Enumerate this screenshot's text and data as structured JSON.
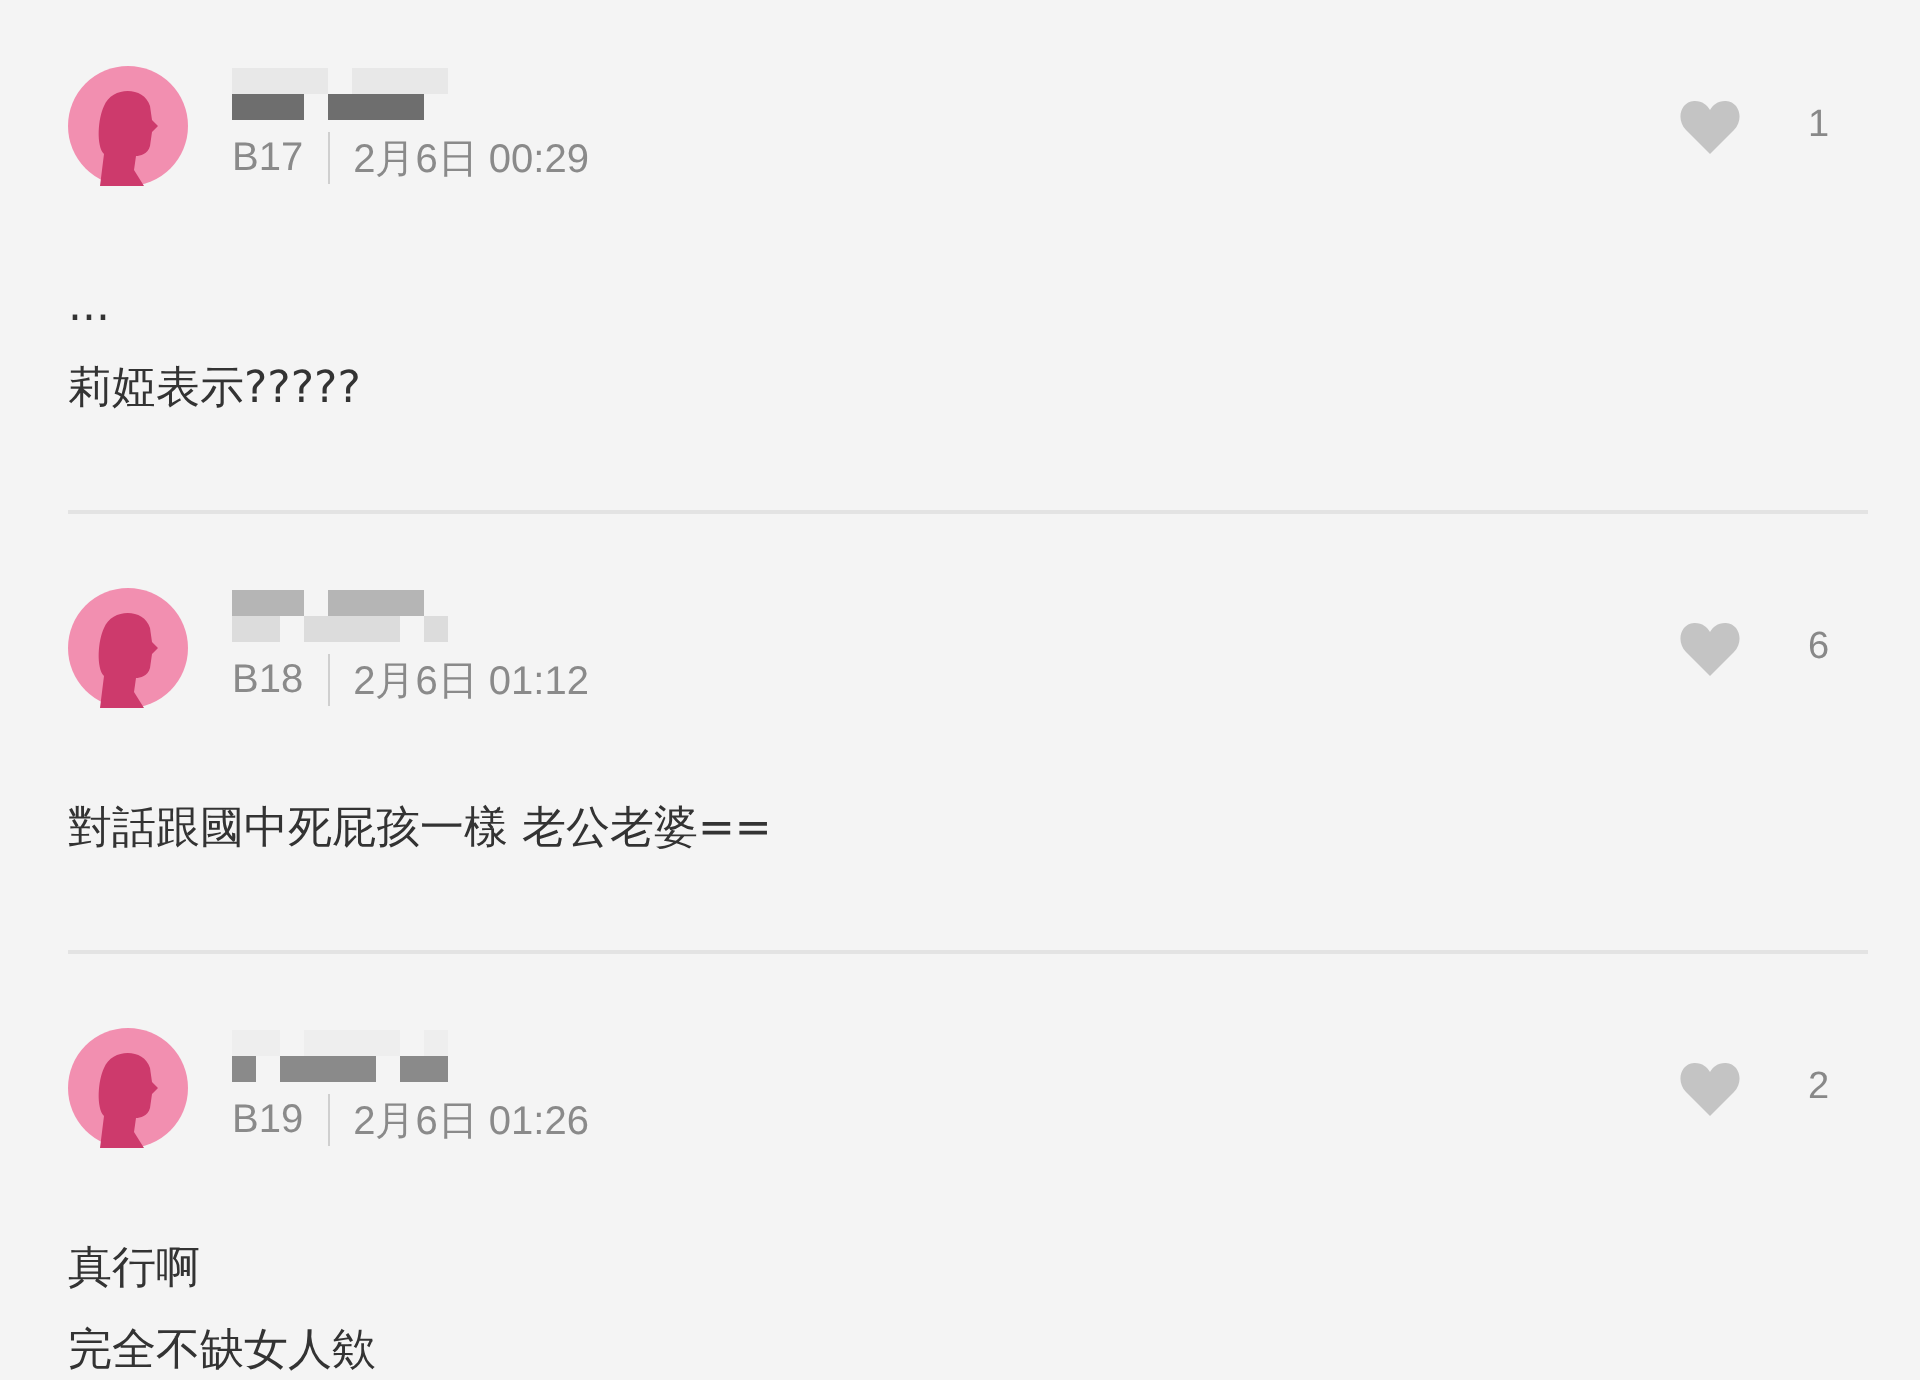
{
  "comments": [
    {
      "floor": "B17",
      "time": "2月6日 00:29",
      "likes": "1",
      "lines": [
        "...",
        "莉婭表示?????"
      ]
    },
    {
      "floor": "B18",
      "time": "2月6日 01:12",
      "likes": "6",
      "lines": [
        "對話跟國中死屁孩一樣 老公老婆=="
      ]
    },
    {
      "floor": "B19",
      "time": "2月6日 01:26",
      "likes": "2",
      "lines": [
        "真行啊",
        "完全不缺女人欸"
      ]
    }
  ]
}
